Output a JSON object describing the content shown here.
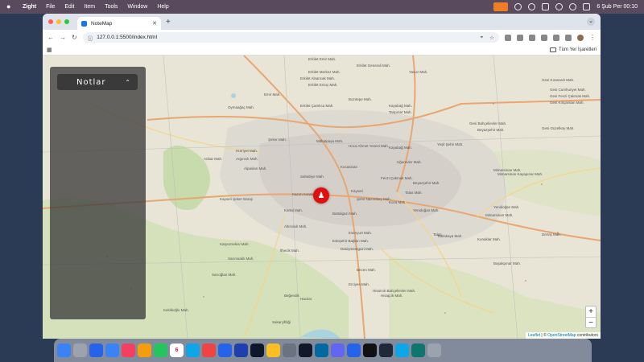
{
  "menubar": {
    "app_name": "Zight",
    "items": [
      "File",
      "Edit",
      "Item",
      "Tools",
      "Window",
      "Help"
    ],
    "clock": "6 Şub Per  00:10"
  },
  "browser": {
    "tab_title": "NoteMap",
    "new_tab": "+",
    "url": "127.0.0.1:5500/index.html",
    "bookmarks_folder": "Tüm Yer İşaretleri"
  },
  "panel": {
    "title": "Notlar",
    "chevron": "⌃"
  },
  "map": {
    "labels": [
      "Erkilet Emir Mah.",
      "Erkilet Generali Mah.",
      "Erkilet Merkez Mah.",
      "Erkilet Alsancak Mah.",
      "Erkilet Ersoy Mah.",
      "Yavuz Mah.",
      "Emir Mah.",
      "Bozıtepe Mah.",
      "Oymaağaç Mah.",
      "Kayabağ Mah.",
      "Erkilet Çamlıca Mah.",
      "Tanpınar Mah.",
      "Gesi Cumhuriyet Mah.",
      "Gesi Fevzi Çakmak Mah.",
      "Gesi Kılıçarslan Mah.",
      "Beyazşehir Mah.",
      "Gesi Bahçelievler Mah.",
      "Gesi Güzelköy Mah.",
      "Gesi Kıranardı Mah.",
      "Şeker Mah.",
      "Mithatpaşa Mah.",
      "Hoca Ahmet Yesevi Mah.",
      "Kayabağ Mah.",
      "Yeşil Şehir Mah.",
      "Hürriyet Mah.",
      "Anbar Mah.",
      "Argıncık Mah.",
      "Kocasinan",
      "Uğurevler Mah.",
      "Mimarsinan Mah.",
      "Alpaslan Mah.",
      "Sahabiye Mah.",
      "Fevzi Çakmak Mah.",
      "Beyazşehir Mah.",
      "Battalgazi Mah.",
      "Kayseri",
      "Şehit Nazımbey Mah.",
      "Koza Mah.",
      "Talas Mah.",
      "Kazım Karabekir Mah.",
      "Kartal Mah.",
      "Yenidoğan Mah.",
      "Talas",
      "Tablakaya Mah.",
      "Altınoluk Mah.",
      "Esenyurt Mah.",
      "Eskişehir Bağları Mah.",
      "Danişmentgazi Mah.",
      "Yenidoğan Mah.",
      "Mimarsinan Mah.",
      "Derviş Mah.",
      "İlhecik Mah.",
      "Becen Mah.",
      "Başakpınar Mah.",
      "Karpuzsekisi Mah.",
      "Erciyes Mah.",
      "Hisarcık Bahçelievler Mah.",
      "Beğendik",
      "Hacılar",
      "Sakarçiftliği",
      "Keklikoğlu Mah.",
      "Sarımsaklı Mah.",
      "Kıranardı Mah.",
      "Büyük Bürüngüz Mah.",
      "Kayseri Şeker Barajı",
      "Sarıoğlan Mah.",
      "Mimarsinan Kayapınar Mah.",
      "Konaklar Mah.",
      "Hisarcık Mah."
    ],
    "zoom_in": "+",
    "zoom_out": "−",
    "attribution_leaflet": "Leaflet",
    "attribution_sep": " | © ",
    "attribution_osm": "OpenStreetMap",
    "attribution_tail": " contributors"
  },
  "dock": {
    "icons": [
      "finder",
      "launchpad",
      "safari",
      "mail",
      "music",
      "photos",
      "facetime",
      "calendar",
      "appstore",
      "chrome",
      "vscode",
      "xcode",
      "browser",
      "notes",
      "settings",
      "terminal",
      "outlook",
      "teams",
      "zoom",
      "github",
      "terminal2",
      "telegram",
      "copilot",
      "trash"
    ],
    "calendar_day": "6"
  },
  "colors": {
    "marker": "#e01010",
    "panel_bg": "#3c3c3c",
    "accent": "#1a73e8"
  }
}
